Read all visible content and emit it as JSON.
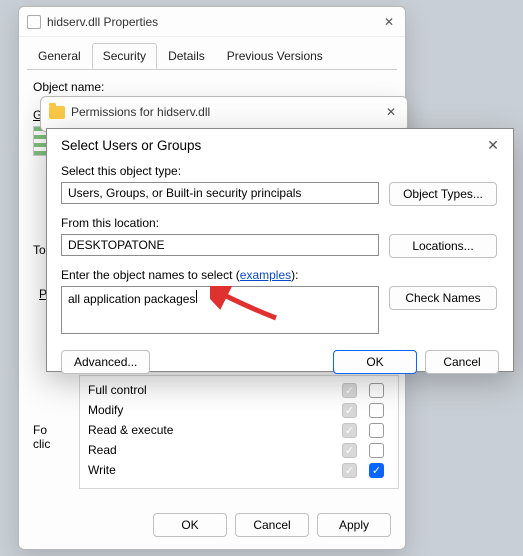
{
  "properties": {
    "title": "hidserv.dll Properties",
    "tabs": [
      "General",
      "Security",
      "Details",
      "Previous Versions"
    ],
    "active_tab": 1,
    "object_label": "Object name:",
    "groups_label": "Gr",
    "to_label": "To",
    "perm_header_prefix": "P",
    "for_line1": "Fo",
    "for_line2": "clic",
    "perms": [
      {
        "name": "Full control",
        "allow": true,
        "deny": false
      },
      {
        "name": "Modify",
        "allow": true,
        "deny": false
      },
      {
        "name": "Read & execute",
        "allow": true,
        "deny": false
      },
      {
        "name": "Read",
        "allow": true,
        "deny": false
      },
      {
        "name": "Write",
        "allow": true,
        "deny": true
      }
    ],
    "buttons": {
      "ok": "OK",
      "cancel": "Cancel",
      "apply": "Apply"
    }
  },
  "perm_dialog": {
    "title": "Permissions for hidserv.dll"
  },
  "select_dialog": {
    "title": "Select Users or Groups",
    "object_type_label": "Select this object type:",
    "object_type_value": "Users, Groups, or Built-in security principals",
    "object_types_btn": "Object Types...",
    "location_label": "From this location:",
    "location_value": "DESKTOPATONE",
    "locations_btn": "Locations...",
    "names_label_pre": "Enter the object names to select (",
    "names_label_link": "examples",
    "names_label_post": "):",
    "names_value": "all application packages",
    "check_names_btn": "Check Names",
    "advanced_btn": "Advanced...",
    "ok_btn": "OK",
    "cancel_btn": "Cancel"
  }
}
